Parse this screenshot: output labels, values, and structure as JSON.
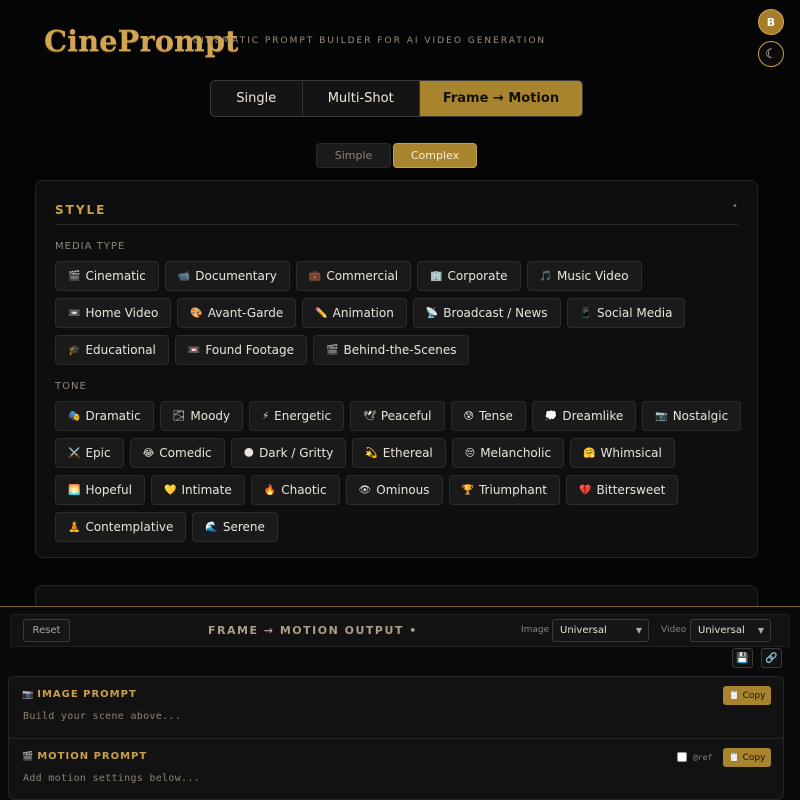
{
  "header": {
    "logo": "CinePrompt",
    "tagline": "CINEMATIC PROMPT BUILDER FOR AI VIDEO GENERATION",
    "avatar_initial": "B",
    "theme_glyph": "☾"
  },
  "mode_tabs": [
    {
      "label": "Single",
      "active": false
    },
    {
      "label": "Multi-Shot",
      "active": false
    },
    {
      "label": "Frame → Motion",
      "active": true
    }
  ],
  "sub_tabs": [
    {
      "label": "Simple",
      "active": false
    },
    {
      "label": "Complex",
      "active": true
    }
  ],
  "style_panel": {
    "title": "STYLE",
    "collapse_glyph": "•",
    "media_type_label": "MEDIA TYPE",
    "media_types": [
      {
        "icon": "🎬",
        "label": "Cinematic"
      },
      {
        "icon": "📹",
        "label": "Documentary"
      },
      {
        "icon": "💼",
        "label": "Commercial"
      },
      {
        "icon": "🏢",
        "label": "Corporate"
      },
      {
        "icon": "🎵",
        "label": "Music Video"
      },
      {
        "icon": "📼",
        "label": "Home Video"
      },
      {
        "icon": "🎨",
        "label": "Avant-Garde"
      },
      {
        "icon": "✏️",
        "label": "Animation"
      },
      {
        "icon": "📡",
        "label": "Broadcast / News"
      },
      {
        "icon": "📱",
        "label": "Social Media"
      },
      {
        "icon": "🎓",
        "label": "Educational"
      },
      {
        "icon": "📼",
        "label": "Found Footage"
      },
      {
        "icon": "🎬",
        "label": "Behind-the-Scenes"
      }
    ],
    "tone_label": "TONE",
    "tones": [
      {
        "icon": "🎭",
        "label": "Dramatic"
      },
      {
        "icon": "🌫",
        "label": "Moody"
      },
      {
        "icon": "⚡",
        "label": "Energetic"
      },
      {
        "icon": "🕊",
        "label": "Peaceful"
      },
      {
        "icon": "😰",
        "label": "Tense"
      },
      {
        "icon": "💭",
        "label": "Dreamlike"
      },
      {
        "icon": "📷",
        "label": "Nostalgic"
      },
      {
        "icon": "⚔️",
        "label": "Epic"
      },
      {
        "icon": "😂",
        "label": "Comedic"
      },
      {
        "icon": "🌑",
        "label": "Dark / Gritty"
      },
      {
        "icon": "💫",
        "label": "Ethereal"
      },
      {
        "icon": "😔",
        "label": "Melancholic"
      },
      {
        "icon": "🤗",
        "label": "Whimsical"
      },
      {
        "icon": "🌅",
        "label": "Hopeful"
      },
      {
        "icon": "💛",
        "label": "Intimate"
      },
      {
        "icon": "🔥",
        "label": "Chaotic"
      },
      {
        "icon": "👁",
        "label": "Ominous"
      },
      {
        "icon": "🏆",
        "label": "Triumphant"
      },
      {
        "icon": "💔",
        "label": "Bittersweet"
      },
      {
        "icon": "🧘",
        "label": "Contemplative"
      },
      {
        "icon": "🌊",
        "label": "Serene"
      }
    ]
  },
  "output": {
    "reset_label": "Reset",
    "title": "FRAME → MOTION OUTPUT",
    "title_dot": "•",
    "image_label": "Image",
    "image_value": "Universal",
    "video_label": "Video",
    "video_value": "Universal",
    "save_glyph": "💾",
    "link_glyph": "🔗",
    "image_prompt": {
      "icon": "📷",
      "title": "IMAGE PROMPT",
      "placeholder": "Build your scene above...",
      "copy_label": "📋 Copy"
    },
    "motion_prompt": {
      "icon": "🎬",
      "title": "MOTION PROMPT",
      "placeholder": "Add motion settings below...",
      "ref_label": "@ref",
      "copy_label": "📋 Copy"
    }
  },
  "colors": {
    "accent": "#a8842f",
    "gold_text": "#c9a049",
    "background": "#050505"
  }
}
